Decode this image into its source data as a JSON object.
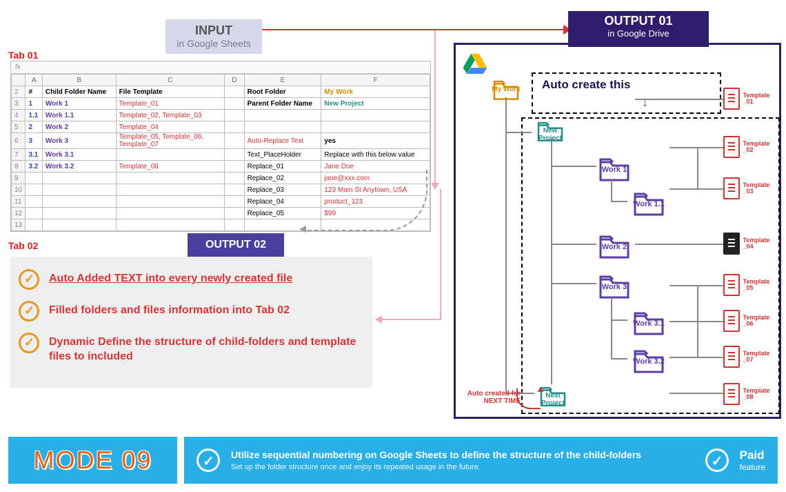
{
  "input": {
    "title": "INPUT",
    "sub": "in Google Sheets"
  },
  "output1": {
    "title": "OUTPUT 01",
    "sub": "in Google Drive"
  },
  "output2": {
    "title": "OUTPUT 02"
  },
  "tabs": {
    "t1": "Tab 01",
    "t2": "Tab 02"
  },
  "sheet": {
    "cols": [
      "A",
      "B",
      "C",
      "D",
      "E",
      "F"
    ],
    "hdr_main": {
      "a": "#",
      "b": "Child Folder Name",
      "c": "File Template",
      "e": "Root Folder",
      "f": "My Work"
    },
    "r3": {
      "a": "1",
      "b": "Work 1",
      "c": "Template_01",
      "e": "Parent Folder Name",
      "f": "New Project"
    },
    "r4": {
      "a": "1.1",
      "b": "Work 1.1",
      "c": "Template_02, Template_03"
    },
    "r5": {
      "a": "2",
      "b": "Work 2",
      "c": "Template_04"
    },
    "r6": {
      "a": "3",
      "b": "Work 3",
      "c": "Template_05, Template_06, Template_07",
      "e": "Auto-Replace Text",
      "f": "yes"
    },
    "r7": {
      "a": "3.1",
      "b": "Work 3.1",
      "e": "Text_PlaceHolder",
      "f": "Replace with this below value"
    },
    "r8": {
      "a": "3.2",
      "b": "Work 3.2",
      "c": "Template_08",
      "e": "Replace_01",
      "f": "Jane Doe"
    },
    "r9": {
      "e": "Replace_02",
      "f": "jane@xxx.com"
    },
    "r10": {
      "e": "Replace_03",
      "f": "123 Main St Anytown, USA"
    },
    "r11": {
      "e": "Replace_04",
      "f": "product_123"
    },
    "r12": {
      "e": "Replace_05",
      "f": "$99"
    }
  },
  "out2": {
    "i1": "Auto Added TEXT into every newly created file",
    "i2": "Filled folders and files information into Tab 02",
    "i3": "Dynamic Define the structure of child-folders and template files to included"
  },
  "drive": {
    "auto": "Auto create this",
    "next": "Auto created for NEXT TIME",
    "f": {
      "mywork": "My Work",
      "newproject": "New Project",
      "w1": "Work 1",
      "w11": "Work 1.1",
      "w2": "Work 2",
      "w3": "Work 3",
      "w31": "Work 3.1",
      "w32": "Work 3.2",
      "next": "Next Project"
    },
    "tmpl": {
      "t1": "Template _01",
      "t2": "Template _02",
      "t3": "Template _03",
      "t4": "Template _04",
      "t5": "Template _05",
      "t6": "Template _06",
      "t7": "Template _07",
      "t8": "Template _08"
    }
  },
  "bottom": {
    "mode": "MODE 09",
    "d1": "Utilize sequential numbering on Google Sheets to define the structure of the child-folders",
    "d2": "Set up the folder structure once and enjoy its repeated usage in the future.",
    "p1": "Paid",
    "p2": "feature"
  }
}
